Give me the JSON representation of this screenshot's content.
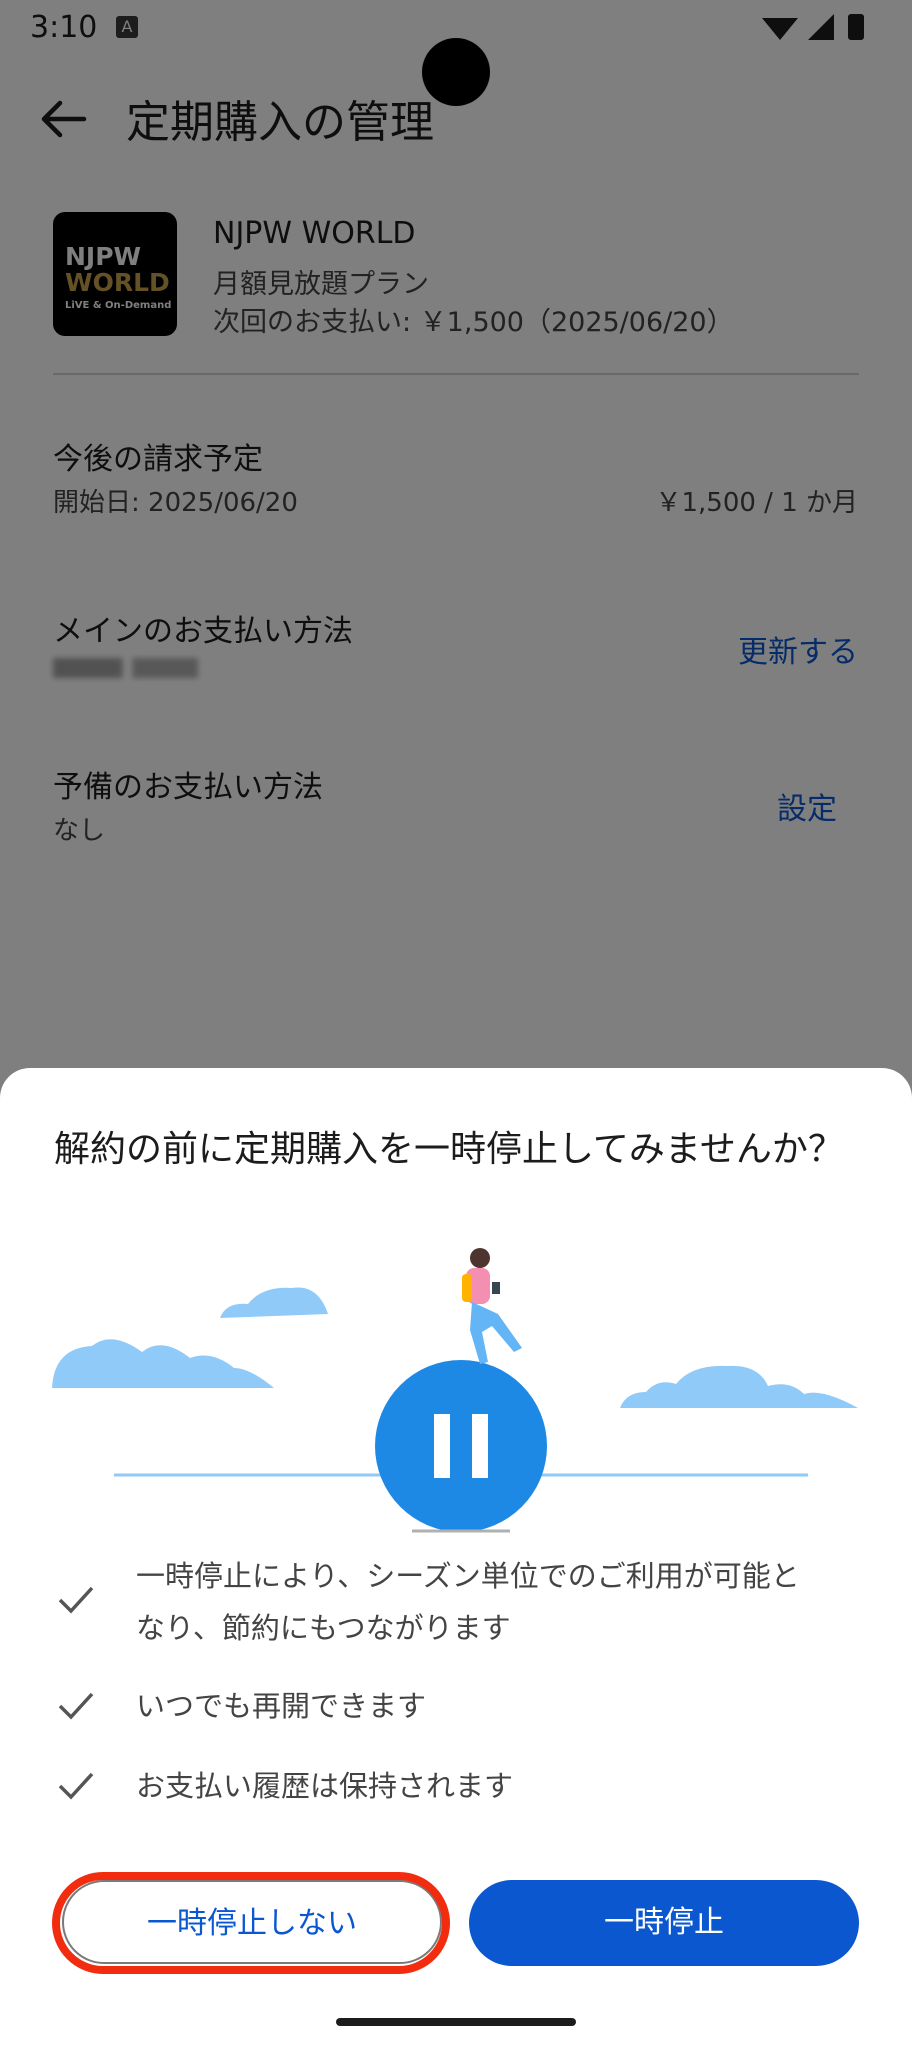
{
  "status_bar": {
    "time": "3:10",
    "badge": "A"
  },
  "app_bar": {
    "title": "定期購入の管理",
    "back_icon": "arrow-back-icon"
  },
  "product": {
    "logo_line1": "NJPW",
    "logo_line2": "WORLD",
    "logo_line3": "LiVE & On-Demand",
    "name": "NJPW WORLD",
    "plan": "月額見放題プラン",
    "next_payment": "次回のお支払い: ￥1,500（2025/06/20）"
  },
  "billing": {
    "title": "今後の請求予定",
    "start_date": "開始日: 2025/06/20",
    "price": "￥1,500 / 1 か月"
  },
  "primary_payment": {
    "title": "メインのお支払い方法",
    "update_label": "更新する"
  },
  "backup_payment": {
    "title": "予備のお支払い方法",
    "value": "なし",
    "set_label": "設定"
  },
  "sheet": {
    "title": "解約の前に定期購入を一時停止してみませんか？",
    "benefits": [
      {
        "line1": "一時停止により、シーズン単位でのご利用が可能と",
        "line2": "なり、節約にもつながります"
      },
      {
        "line1": "いつでも再開できます"
      },
      {
        "line1": "お支払い履歴は保持されます"
      }
    ],
    "decline_label": "一時停止しない",
    "pause_label": "一時停止"
  },
  "colors": {
    "accent": "#0b57d0",
    "highlight": "#f22c0f",
    "illustration_blue": "#1e88e5",
    "cloud": "#90caf9"
  }
}
